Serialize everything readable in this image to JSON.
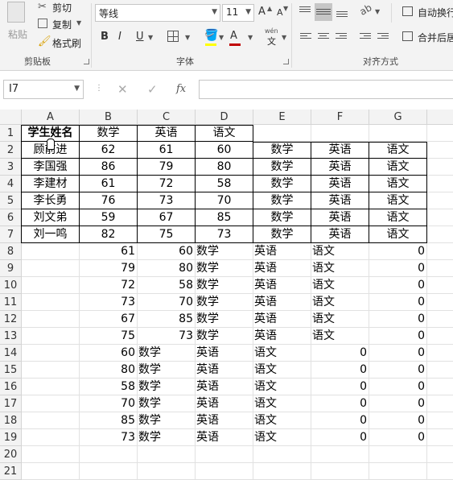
{
  "clipboard": {
    "paste": "粘贴",
    "cut": "剪切",
    "copy": "复制",
    "format_painter": "格式刷",
    "group": "剪贴板"
  },
  "font": {
    "name": "等线",
    "size": "11",
    "grow": "A",
    "shrink": "A",
    "bold": "B",
    "italic": "I",
    "underline": "U",
    "font_color_letter": "A",
    "phonetic_top": "wén",
    "phonetic_bottom": "文",
    "group": "字体"
  },
  "align": {
    "wrap": "自动换行",
    "merge": "合并后居",
    "group": "对齐方式"
  },
  "formula_bar": {
    "cell_ref": "I7",
    "fx": "fx",
    "value": ""
  },
  "columns": [
    "A",
    "B",
    "C",
    "D",
    "E",
    "F",
    "G"
  ],
  "rows": [
    "1",
    "2",
    "3",
    "4",
    "5",
    "6",
    "7",
    "8",
    "9",
    "10",
    "11",
    "12",
    "13",
    "14",
    "15",
    "16",
    "17",
    "18",
    "19",
    "20",
    "21"
  ],
  "sheet": {
    "r1": [
      "学生姓名",
      "数学",
      "英语",
      "语文",
      "",
      ""
    ],
    "r2": [
      "顾前进",
      "62",
      "61",
      "60",
      "数学",
      "英语",
      "语文"
    ],
    "r3": [
      "李国强",
      "86",
      "79",
      "80",
      "数学",
      "英语",
      "语文"
    ],
    "r4": [
      "李建材",
      "61",
      "72",
      "58",
      "数学",
      "英语",
      "语文"
    ],
    "r5": [
      "李长勇",
      "76",
      "73",
      "70",
      "数学",
      "英语",
      "语文"
    ],
    "r6": [
      "刘文弟",
      "59",
      "67",
      "85",
      "数学",
      "英语",
      "语文"
    ],
    "r7": [
      "刘一鸣",
      "82",
      "75",
      "73",
      "数学",
      "英语",
      "语文"
    ],
    "r8": [
      "61",
      "60",
      "数学",
      "英语",
      "语文",
      "0"
    ],
    "r9": [
      "79",
      "80",
      "数学",
      "英语",
      "语文",
      "0"
    ],
    "r10": [
      "72",
      "58",
      "数学",
      "英语",
      "语文",
      "0"
    ],
    "r11": [
      "73",
      "70",
      "数学",
      "英语",
      "语文",
      "0"
    ],
    "r12": [
      "67",
      "85",
      "数学",
      "英语",
      "语文",
      "0"
    ],
    "r13": [
      "75",
      "73",
      "数学",
      "英语",
      "语文",
      "0"
    ],
    "r14": [
      "60",
      "数学",
      "英语",
      "语文",
      "0",
      "0"
    ],
    "r15": [
      "80",
      "数学",
      "英语",
      "语文",
      "0",
      "0"
    ],
    "r16": [
      "58",
      "数学",
      "英语",
      "语文",
      "0",
      "0"
    ],
    "r17": [
      "70",
      "数学",
      "英语",
      "语文",
      "0",
      "0"
    ],
    "r18": [
      "85",
      "数学",
      "英语",
      "语文",
      "0",
      "0"
    ],
    "r19": [
      "73",
      "数学",
      "英语",
      "语文",
      "0",
      "0"
    ]
  },
  "colors": {
    "font_color": "#c00000",
    "grid_line": "#e1e1e1",
    "header_bg": "#f3f3f3"
  }
}
